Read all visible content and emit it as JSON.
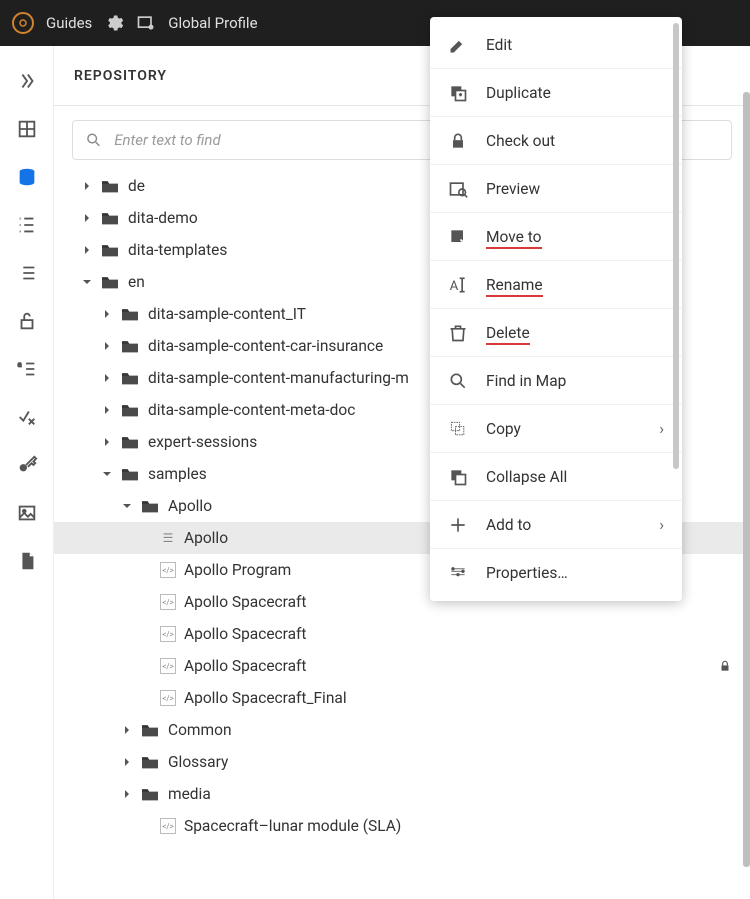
{
  "topbar": {
    "app": "Guides",
    "profile": "Global Profile"
  },
  "panel": {
    "title": "REPOSITORY",
    "search_placeholder": "Enter text to find"
  },
  "tree": [
    {
      "depth": 0,
      "expand": "closed",
      "type": "folder",
      "label": "de"
    },
    {
      "depth": 0,
      "expand": "closed",
      "type": "folder",
      "label": "dita-demo"
    },
    {
      "depth": 0,
      "expand": "closed",
      "type": "folder",
      "label": "dita-templates"
    },
    {
      "depth": 0,
      "expand": "open",
      "type": "folder",
      "label": "en"
    },
    {
      "depth": 1,
      "expand": "closed",
      "type": "folder",
      "label": "dita-sample-content_IT"
    },
    {
      "depth": 1,
      "expand": "closed",
      "type": "folder",
      "label": "dita-sample-content-car-insurance"
    },
    {
      "depth": 1,
      "expand": "closed",
      "type": "folder",
      "label": "dita-sample-content-manufacturing-m"
    },
    {
      "depth": 1,
      "expand": "closed",
      "type": "folder",
      "label": "dita-sample-content-meta-doc"
    },
    {
      "depth": 1,
      "expand": "closed",
      "type": "folder",
      "label": "expert-sessions"
    },
    {
      "depth": 1,
      "expand": "open",
      "type": "folder",
      "label": "samples"
    },
    {
      "depth": 2,
      "expand": "open",
      "type": "folder",
      "label": "Apollo"
    },
    {
      "depth": 3,
      "expand": "none",
      "type": "map",
      "label": "Apollo",
      "selected": true
    },
    {
      "depth": 3,
      "expand": "none",
      "type": "doc",
      "label": "Apollo Program"
    },
    {
      "depth": 3,
      "expand": "none",
      "type": "doc",
      "label": "Apollo Spacecraft"
    },
    {
      "depth": 3,
      "expand": "none",
      "type": "doc",
      "label": "Apollo Spacecraft"
    },
    {
      "depth": 3,
      "expand": "none",
      "type": "doc",
      "label": "Apollo Spacecraft",
      "locked": true
    },
    {
      "depth": 3,
      "expand": "none",
      "type": "doc",
      "label": "Apollo Spacecraft_Final"
    },
    {
      "depth": 2,
      "expand": "closed",
      "type": "folder",
      "label": "Common"
    },
    {
      "depth": 2,
      "expand": "closed",
      "type": "folder",
      "label": "Glossary"
    },
    {
      "depth": 2,
      "expand": "closed",
      "type": "folder",
      "label": "media"
    },
    {
      "depth": 3,
      "expand": "none",
      "type": "doc",
      "label": "Spacecraft–lunar module (SLA)"
    }
  ],
  "ctx": [
    {
      "icon": "pencil",
      "label": "Edit"
    },
    {
      "icon": "dup",
      "label": "Duplicate"
    },
    {
      "icon": "lock",
      "label": "Check out"
    },
    {
      "icon": "preview",
      "label": "Preview"
    },
    {
      "icon": "move",
      "label": "Move to",
      "red": true
    },
    {
      "icon": "rename",
      "label": "Rename",
      "red": true
    },
    {
      "icon": "trash",
      "label": "Delete",
      "red": true
    },
    {
      "icon": "search",
      "label": "Find in Map"
    },
    {
      "icon": "copy",
      "label": "Copy",
      "chev": true
    },
    {
      "icon": "collapse",
      "label": "Collapse All"
    },
    {
      "icon": "add",
      "label": "Add to",
      "chev": true
    },
    {
      "icon": "props",
      "label": "Properties…"
    }
  ]
}
